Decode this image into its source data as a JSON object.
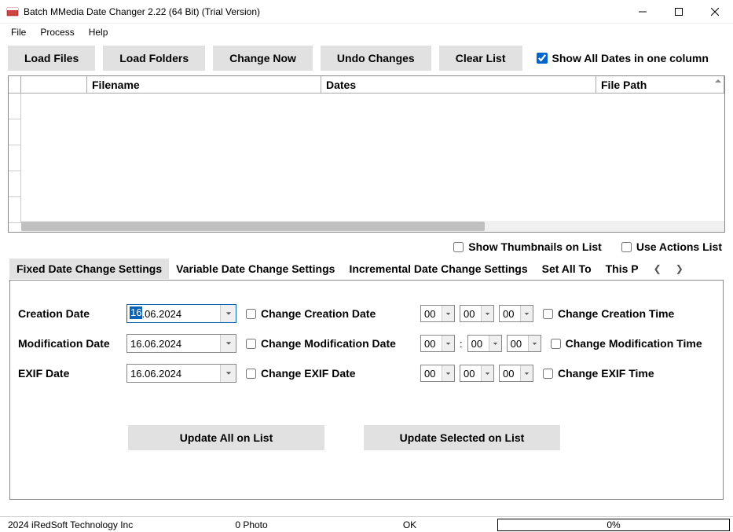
{
  "window": {
    "title": "Batch MMedia Date Changer 2.22 (64 Bit) (Trial Version)"
  },
  "menu": {
    "file": "File",
    "process": "Process",
    "help": "Help"
  },
  "toolbar": {
    "load_files": "Load Files",
    "load_folders": "Load Folders",
    "change_now": "Change Now",
    "undo": "Undo Changes",
    "clear": "Clear List",
    "show_all_dates": "Show All Dates in one column",
    "show_all_dates_checked": true
  },
  "columns": {
    "filename": "Filename",
    "dates": "Dates",
    "path": "File Path"
  },
  "options": {
    "show_thumbs": "Show Thumbnails on List",
    "use_actions": "Use Actions List"
  },
  "tabs": {
    "fixed": "Fixed Date Change Settings",
    "variable": "Variable Date Change Settings",
    "incremental": "Incremental Date Change Settings",
    "set_all": "Set All To",
    "this_p": "This P"
  },
  "form": {
    "creation_label": "Creation Date",
    "modification_label": "Modification Date",
    "exif_label": "EXIF Date",
    "creation_date": "16.06.2024",
    "creation_sel": "16",
    "modification_date": "16.06.2024",
    "exif_date": "16.06.2024",
    "chg_creation_date": "Change Creation Date",
    "chg_modification_date": "Change Modification Date",
    "chg_exif_date": "Change EXIF Date",
    "chg_creation_time": "Change Creation Time",
    "chg_modification_time": "Change Modification Time",
    "chg_exif_time": "Change EXIF Time",
    "h": "00",
    "m": "00",
    "s": "00",
    "update_all": "Update All on List",
    "update_selected": "Update Selected on List"
  },
  "status": {
    "company": "2024 iRedSoft Technology Inc",
    "count": "0 Photo",
    "ok": "OK",
    "progress": "0%"
  }
}
